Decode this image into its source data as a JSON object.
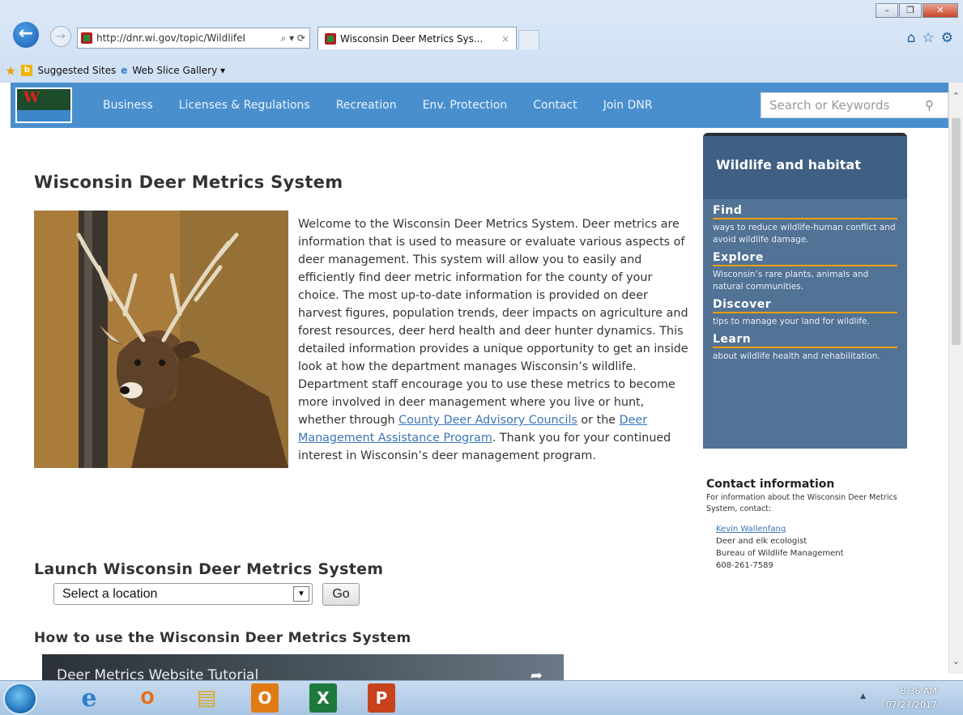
{
  "browser": {
    "address_url": "http://dnr.wi.gov/topic/Wildlife",
    "address_suffix": "I",
    "address_controls": "⌕ ▾ ⟳",
    "tab_title": "Wisconsin Deer Metrics Sys...",
    "tab_close": "×",
    "window_buttons": {
      "minimize": "–",
      "restore": "❐",
      "close": "✕"
    },
    "icons": {
      "home": "⌂",
      "favorites": "☆",
      "tools": "⚙"
    },
    "favorites_bar": {
      "suggested_sites": "Suggested Sites",
      "web_slice_gallery": "Web Slice Gallery ▾"
    }
  },
  "site_nav": {
    "items": [
      "Business",
      "Licenses & Regulations",
      "Recreation",
      "Env. Protection",
      "Contact",
      "Join DNR"
    ],
    "search_placeholder": "Search or Keywords",
    "logo_letter": "W"
  },
  "main": {
    "title": "Wisconsin Deer Metrics System",
    "intro_text_1": "Welcome to the Wisconsin Deer Metrics System. Deer metrics are information that is used to measure or evaluate various aspects of deer management. This system will allow you to easily and efficiently find deer metric information for the county of your choice. The most up-to-date information is provided on deer harvest figures, population trends, deer impacts on agriculture and forest resources, deer herd health and deer hunter dynamics. This detailed information provides a unique opportunity to get an inside look at how the department manages Wisconsin’s wildlife. Department staff encourage you to use these metrics to become more involved in deer management where you live or hunt, whether through ",
    "link_cdac": "County Deer Advisory Councils",
    "intro_text_2": " or the ",
    "link_dmap": "Deer Management Assistance Program",
    "intro_text_3": ". Thank you for your continued interest in Wisconsin’s deer management program.",
    "launch_heading": "Launch Wisconsin Deer Metrics System",
    "select_value": "Select a location",
    "go_label": "Go",
    "howto_heading": "How to use the Wisconsin Deer Metrics System",
    "video_title": "Deer Metrics Website Tutorial"
  },
  "sidebar": {
    "header": "Wildlife and habitat",
    "sections": [
      {
        "title": "Find",
        "desc": "ways to reduce wildlife-human conflict and avoid wildlife damage."
      },
      {
        "title": "Explore",
        "desc": "Wisconsin’s rare plants, animals and natural communities."
      },
      {
        "title": "Discover",
        "desc": "tips to manage your land for wildlife."
      },
      {
        "title": "Learn",
        "desc": "about wildlife health and rehabilitation."
      }
    ],
    "contact": {
      "heading": "Contact information",
      "desc": "For information about the Wisconsin Deer Metrics System, contact:",
      "name": "Kevin Wallenfang",
      "role": "Deer and elk ecologist",
      "bureau": "Bureau of Wildlife Management",
      "phone": "608-261-7589"
    }
  },
  "taskbar": {
    "time": "8:36 AM",
    "date": "07/27/2017",
    "apps": [
      "internet-explorer",
      "media-player",
      "file-explorer",
      "outlook",
      "excel",
      "powerpoint"
    ],
    "app_glyphs": [
      "e",
      "O",
      "▤",
      "O",
      "X",
      "P"
    ]
  },
  "colors": {
    "nav_bg": "#4a8fcd",
    "sidebar_bg": "#527296",
    "accent_rule": "#f0a000",
    "link": "#3a75b8"
  }
}
